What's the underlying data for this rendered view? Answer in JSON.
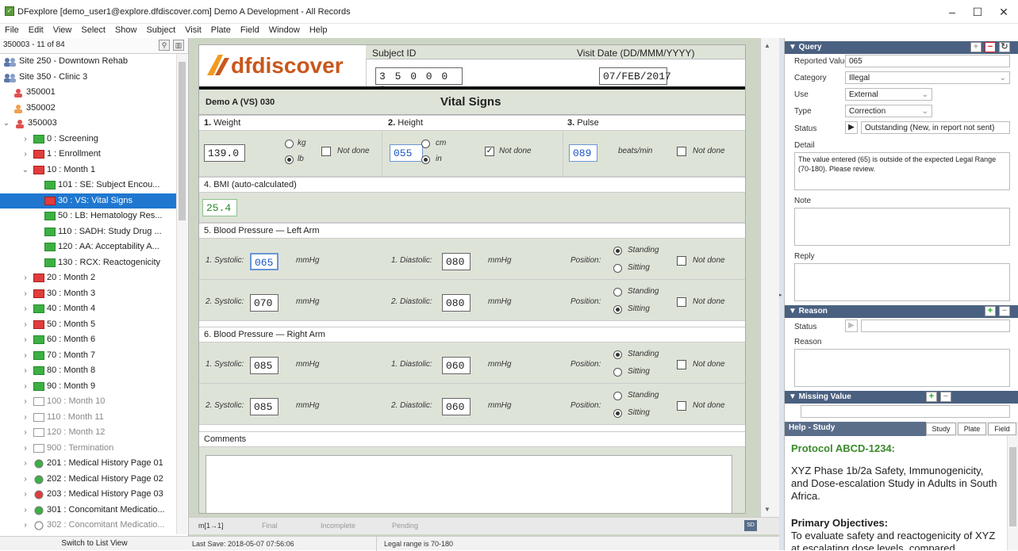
{
  "window": {
    "title": "DFexplore [demo_user1@explore.dfdiscover.com] Demo A Development - All Records"
  },
  "menu": [
    "File",
    "Edit",
    "View",
    "Select",
    "Show",
    "Subject",
    "Visit",
    "Plate",
    "Field",
    "Window",
    "Help"
  ],
  "left": {
    "counter": "350003 - 11 of 84",
    "footer": "Switch to List View",
    "tree": [
      {
        "label": "Site 250 - Downtown Rehab",
        "icon": "site-icon",
        "indent": 0,
        "chev": ""
      },
      {
        "label": "Site 350 - Clinic 3",
        "icon": "site-icon",
        "indent": 0,
        "chev": ""
      },
      {
        "label": "350001",
        "icon": "subject-red",
        "indent": 1,
        "chev": ""
      },
      {
        "label": "350002",
        "icon": "subject-orange",
        "indent": 1,
        "chev": ""
      },
      {
        "label": "350003",
        "icon": "subject-red",
        "indent": 0,
        "chev": "v"
      },
      {
        "label": "0 : Screening",
        "icon": "grn",
        "indent": 2,
        "chev": ">"
      },
      {
        "label": "1 : Enrollment",
        "icon": "red",
        "indent": 2,
        "chev": ">"
      },
      {
        "label": "10 : Month 1",
        "icon": "red",
        "indent": 2,
        "chev": "v"
      },
      {
        "label": "101 : SE: Subject Encou...",
        "icon": "grn",
        "indent": 3,
        "chev": ""
      },
      {
        "label": "30 : VS: Vital Signs",
        "icon": "red",
        "indent": 3,
        "chev": "",
        "selected": true
      },
      {
        "label": "50 : LB: Hematology Res...",
        "icon": "grn",
        "indent": 3,
        "chev": ""
      },
      {
        "label": "110 : SADH: Study Drug ...",
        "icon": "grn",
        "indent": 3,
        "chev": ""
      },
      {
        "label": "120 : AA: Acceptability A...",
        "icon": "grn",
        "indent": 3,
        "chev": ""
      },
      {
        "label": "130 : RCX: Reactogenicity",
        "icon": "grn",
        "indent": 3,
        "chev": ""
      },
      {
        "label": "20 : Month 2",
        "icon": "red",
        "indent": 2,
        "chev": ">"
      },
      {
        "label": "30 : Month 3",
        "icon": "red",
        "indent": 2,
        "chev": ">"
      },
      {
        "label": "40 : Month 4",
        "icon": "grn",
        "indent": 2,
        "chev": ">"
      },
      {
        "label": "50 : Month 5",
        "icon": "red",
        "indent": 2,
        "chev": ">"
      },
      {
        "label": "60 : Month 6",
        "icon": "grn",
        "indent": 2,
        "chev": ">"
      },
      {
        "label": "70 : Month 7",
        "icon": "grn",
        "indent": 2,
        "chev": ">"
      },
      {
        "label": "80 : Month 8",
        "icon": "grn",
        "indent": 2,
        "chev": ">"
      },
      {
        "label": "90 : Month 9",
        "icon": "grn",
        "indent": 2,
        "chev": ">"
      },
      {
        "label": "100 : Month 10",
        "icon": "gry",
        "indent": 2,
        "chev": ">"
      },
      {
        "label": "110 : Month 11",
        "icon": "gry",
        "indent": 2,
        "chev": ">"
      },
      {
        "label": "120 : Month 12",
        "icon": "gry",
        "indent": 2,
        "chev": ">"
      },
      {
        "label": "900 : Termination",
        "icon": "gry",
        "indent": 2,
        "chev": ">"
      },
      {
        "label": "201 : Medical History Page 01",
        "icon": "grn-round",
        "indent": 2,
        "chev": ">"
      },
      {
        "label": "202 : Medical History Page 02",
        "icon": "grn-round",
        "indent": 2,
        "chev": ">"
      },
      {
        "label": "203 : Medical History Page 03",
        "icon": "red-round",
        "indent": 2,
        "chev": ">"
      },
      {
        "label": "301 : Concomitant Medicatio...",
        "icon": "grn-round",
        "indent": 2,
        "chev": ">"
      },
      {
        "label": "302 : Concomitant Medicatio...",
        "icon": "gry-round",
        "indent": 2,
        "chev": ">"
      }
    ]
  },
  "form": {
    "logo": "dfdiscover",
    "subject_id_label": "Subject ID",
    "subject_id": "3 5 0 0 0 3",
    "visit_date_label": "Visit Date (DD/MMM/YYYY)",
    "visit_date": "07/FEB/2017",
    "plate": "Demo A (VS) 030",
    "title": "Vital Signs",
    "weight_label": "1.",
    "weight_h": "Weight",
    "height_label": "2.",
    "height_h": "Height",
    "pulse_label": "3.",
    "pulse_h": "Pulse",
    "weight": "139.0",
    "kg": "kg",
    "lb": "lb",
    "not_done": "Not done",
    "height": "055",
    "cm": "cm",
    "in": "in",
    "pulse": "089",
    "beats": "beats/min",
    "bmi_h": "4. BMI (auto-calculated)",
    "bmi": "25.4",
    "bp_left_h": "5. Blood Pressure — Left Arm",
    "bp_right_h": "6. Blood Pressure — Right Arm",
    "systolic1": "1. Systolic:",
    "systolic2": "2. Systolic:",
    "diastolic1": "1. Diastolic:",
    "diastolic2": "2. Diastolic:",
    "mmhg": "mmHg",
    "position": "Position:",
    "standing": "Standing",
    "sitting": "Sitting",
    "l_sys1": "065",
    "l_dia1": "080",
    "l_sys2": "070",
    "l_dia2": "080",
    "r_sys1": "085",
    "r_dia1": "060",
    "r_sys2": "085",
    "r_dia2": "060",
    "comments": "Comments"
  },
  "bottom": {
    "m": "m[1→1]",
    "final": "Final",
    "incomplete": "Incomplete",
    "pending": "Pending",
    "sd": "SD"
  },
  "status": {
    "last_save": "Last Save: 2018-05-07 07:56:06",
    "legal": "Legal range is 70-180"
  },
  "query": {
    "header": "▼ Query",
    "reported_label": "Reported Value",
    "reported": "065",
    "category_label": "Category",
    "category": "Illegal",
    "use_label": "Use",
    "use": "External",
    "type_label": "Type",
    "type": "Correction",
    "status_label": "Status",
    "status": "Outstanding (New, in report not sent)",
    "detail_label": "Detail",
    "detail": "The value entered (65) is outside of the expected Legal Range (70-180). Please review.",
    "note_label": "Note",
    "reply_label": "Reply"
  },
  "reason": {
    "header": "▼ Reason",
    "status_label": "Status",
    "reason_label": "Reason"
  },
  "missing": {
    "header": "▼ Missing Value"
  },
  "help": {
    "header": "Help - Study",
    "tabs": [
      "Study",
      "Plate",
      "Field"
    ],
    "title": "Protocol ABCD-1234:",
    "p1": "XYZ Phase 1b/2a Safety, Immunogenicity, and Dose-escalation Study in Adults in South Africa.",
    "obj_h": "Primary Objectives:",
    "obj": "To evaluate safety and reactogenicity of XYZ at escalating dose levels, compared"
  }
}
